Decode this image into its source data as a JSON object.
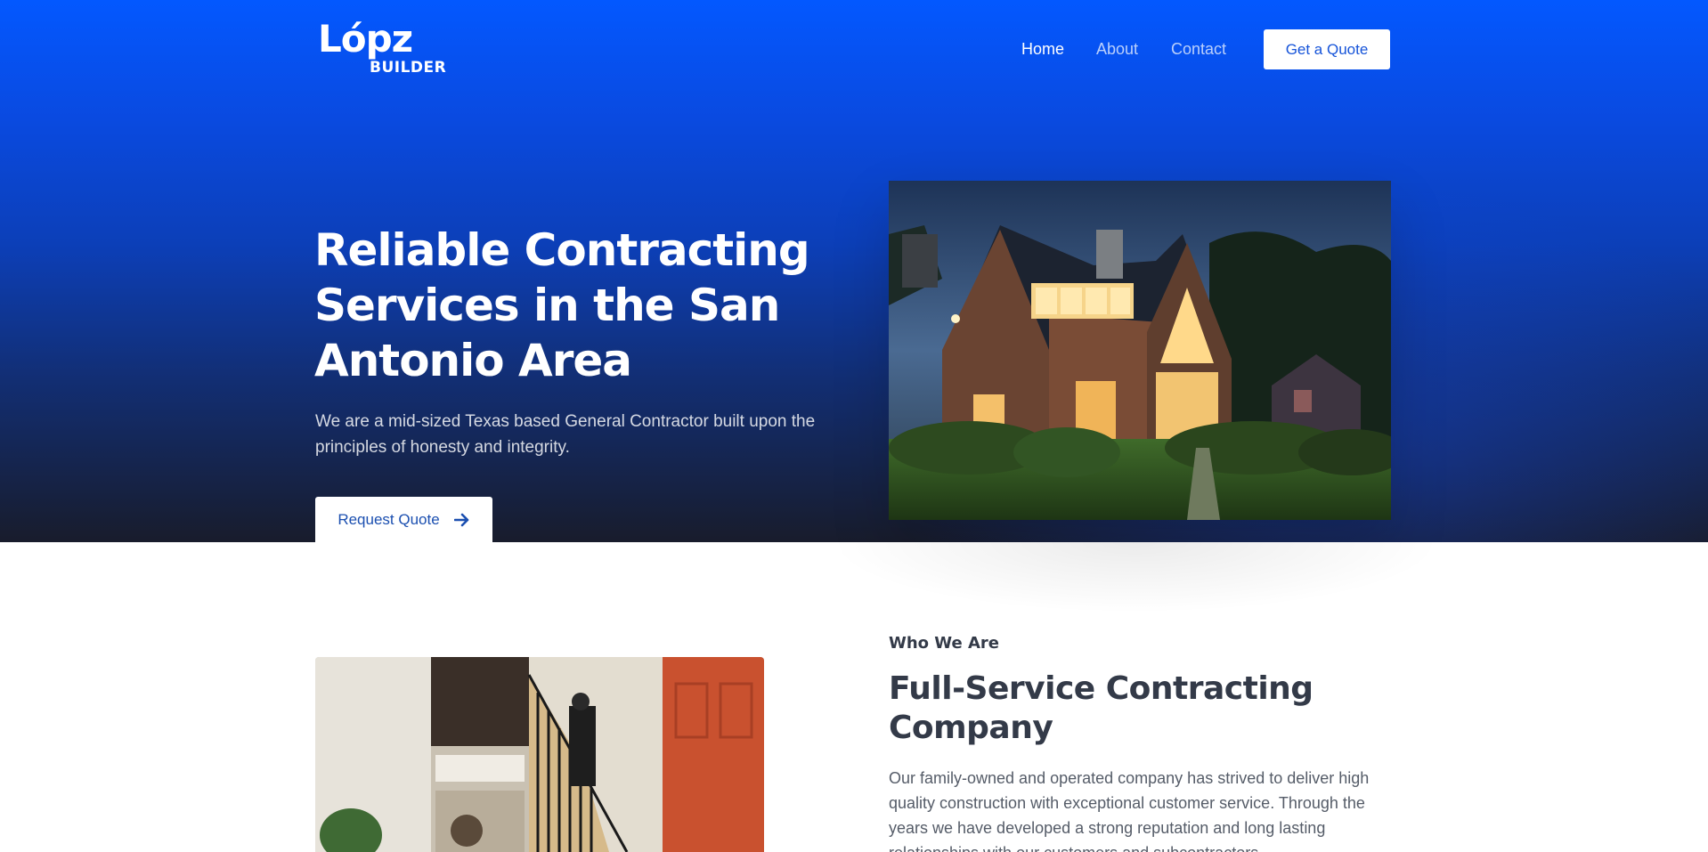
{
  "brand": {
    "name": "Lópz",
    "tagline": "BUILDER"
  },
  "nav": {
    "items": [
      {
        "label": "Home",
        "active": true
      },
      {
        "label": "About",
        "active": false
      },
      {
        "label": "Contact",
        "active": false
      }
    ],
    "cta_label": "Get a Quote"
  },
  "hero": {
    "title": "Reliable Contracting Services in the San Antonio Area",
    "subtitle": "We are a mid-sized Texas based General Contractor built upon the principles of honesty and integrity.",
    "button_label": "Request Quote",
    "button_icon": "arrow-right-icon",
    "image": "house-at-dusk-photo"
  },
  "about": {
    "eyebrow": "Who We Are",
    "title": "Full-Service Contracting Company",
    "body": "Our family-owned and operated company has strived to deliver high quality construction with exceptional customer service. Through the years we have developed a strong reputation and long lasting relationships with our customers and subcontractors.",
    "image": "interior-staircase-photo"
  },
  "colors": {
    "brand_blue": "#0358ff",
    "hero_dark": "#181c2c",
    "button_text": "#1654d9",
    "heading_dark": "#333a48",
    "body_text": "#555c68"
  }
}
